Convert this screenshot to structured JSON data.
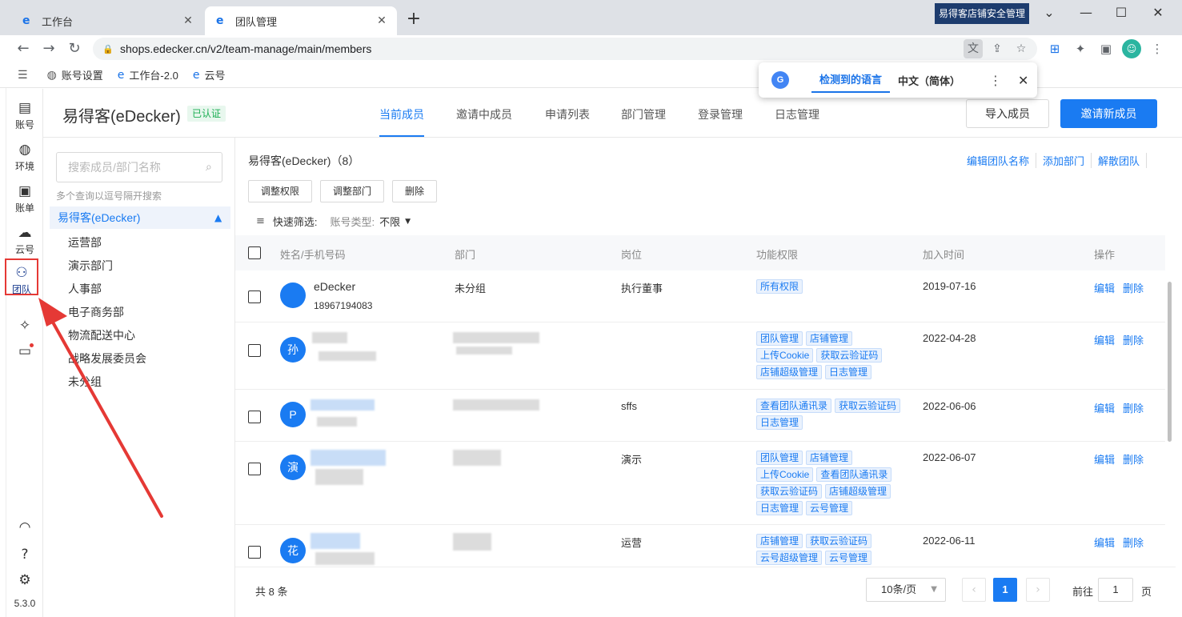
{
  "browser": {
    "tabs": [
      {
        "label": "工作台",
        "active": false
      },
      {
        "label": "团队管理",
        "active": true
      }
    ],
    "new_tab": "+",
    "extension_banner": "易得客店铺安全管理",
    "url": "shops.edecker.cn/v2/team-manage/main/members",
    "bookmarks": [
      "账号设置",
      "工作台-2.0",
      "云号"
    ]
  },
  "translate_popup": {
    "detected": "检测到的语言",
    "target": "中文（简体）"
  },
  "nav": {
    "items": [
      "账号",
      "环境",
      "账单",
      "云号",
      "团队"
    ],
    "active": "团队",
    "version": "5.3.0"
  },
  "header": {
    "company": "易得客(eDecker)",
    "verified": "已认证",
    "tabs": [
      "当前成员",
      "邀请中成员",
      "申请列表",
      "部门管理",
      "登录管理",
      "日志管理"
    ],
    "import_label": "导入成员",
    "invite_label": "邀请新成员"
  },
  "tree": {
    "search_placeholder": "搜索成员/部门名称",
    "hint": "多个查询以逗号隔开搜索",
    "root": "易得客(eDecker)",
    "children": [
      "运营部",
      "演示部门",
      "人事部",
      "电子商务部",
      "物流配送中心",
      "战略发展委员会",
      "未分组"
    ]
  },
  "main": {
    "title": "易得客(eDecker)（8）",
    "top_actions": [
      "编辑团队名称",
      "添加部门",
      "解散团队"
    ],
    "bulk_buttons": [
      "调整权限",
      "调整部门",
      "删除"
    ],
    "filter_label": "快速筛选:",
    "filter_field": "账号类型:",
    "filter_value": "不限",
    "columns": [
      "姓名/手机号码",
      "部门",
      "岗位",
      "功能权限",
      "加入时间",
      "操作"
    ],
    "rows": [
      {
        "avatar": "",
        "name": "eDecker",
        "phone": "18967194083",
        "dept": "未分组",
        "post": "执行董事",
        "perms": [
          "所有权限"
        ],
        "date": "2019-07-16"
      },
      {
        "avatar": "孙",
        "name": "",
        "phone": "",
        "dept": "",
        "post": "",
        "perms": [
          "团队管理",
          "店铺管理",
          "上传Cookie",
          "获取云验证码",
          "店铺超级管理",
          "日志管理"
        ],
        "date": "2022-04-28"
      },
      {
        "avatar": "P",
        "name": "",
        "phone": "",
        "dept": "",
        "post": "sffs",
        "perms": [
          "查看团队通讯录",
          "获取云验证码",
          "日志管理"
        ],
        "date": "2022-06-06"
      },
      {
        "avatar": "演",
        "name": "",
        "phone": "",
        "dept": "",
        "post": "演示",
        "perms": [
          "团队管理",
          "店铺管理",
          "上传Cookie",
          "查看团队通讯录",
          "获取云验证码",
          "店铺超级管理",
          "日志管理",
          "云号管理"
        ],
        "date": "2022-06-07"
      },
      {
        "avatar": "花",
        "name": "",
        "phone": "",
        "dept": "",
        "post": "运营",
        "perms": [
          "店铺管理",
          "获取云验证码",
          "云号超级管理",
          "云号管理"
        ],
        "date": "2022-06-11"
      }
    ],
    "row_actions": [
      "编辑",
      "删除"
    ]
  },
  "pager": {
    "total": "共 8 条",
    "page_size": "10条/页",
    "current": "1",
    "goto_prefix": "前往",
    "goto_value": "1",
    "goto_suffix": "页"
  },
  "colors": {
    "primary": "#1a7bf2",
    "annotation": "#e53935",
    "verified": "#1aad52"
  }
}
